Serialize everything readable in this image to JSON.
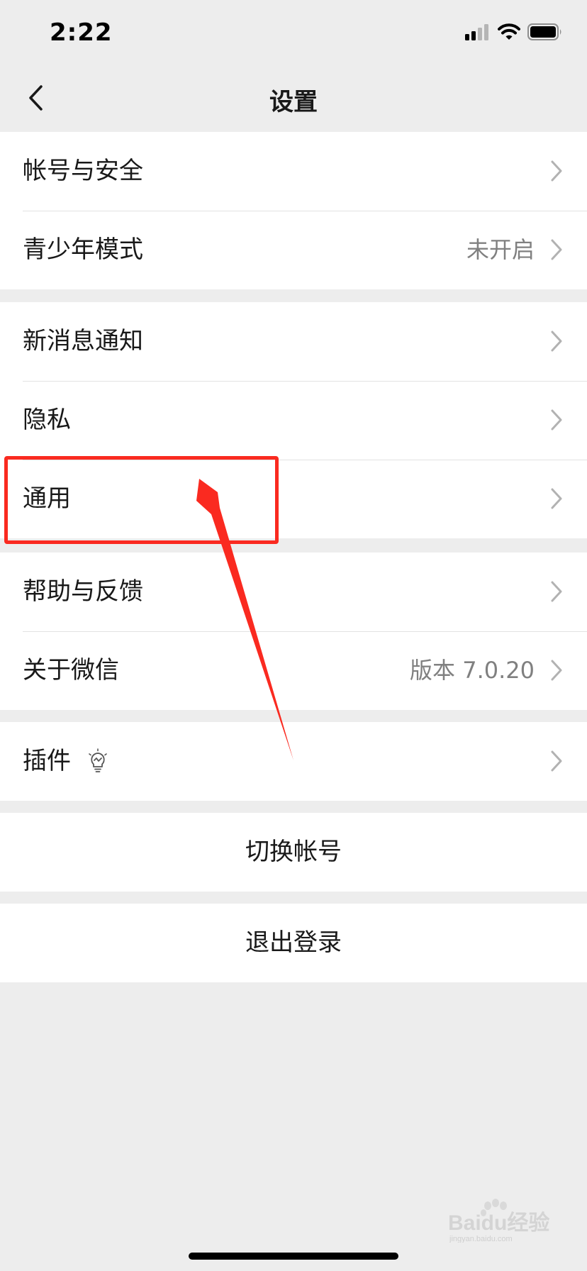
{
  "status_bar": {
    "time": "2:22"
  },
  "nav": {
    "title": "设置"
  },
  "groups": [
    [
      {
        "label": "帐号与安全",
        "value": ""
      },
      {
        "label": "青少年模式",
        "value": "未开启"
      }
    ],
    [
      {
        "label": "新消息通知",
        "value": ""
      },
      {
        "label": "隐私",
        "value": ""
      },
      {
        "label": "通用",
        "value": ""
      }
    ],
    [
      {
        "label": "帮助与反馈",
        "value": ""
      },
      {
        "label": "关于微信",
        "value": "版本 7.0.20"
      }
    ],
    [
      {
        "label": "插件",
        "value": ""
      }
    ]
  ],
  "actions": {
    "switch_account": "切换帐号",
    "logout": "退出登录"
  },
  "watermark": {
    "text": "Baidu经验",
    "sub": "jingyan.baidu.com"
  },
  "icons": [
    "signal-icon",
    "wifi-icon",
    "battery-icon",
    "back-icon",
    "chevron-right-icon",
    "lightbulb-icon"
  ],
  "colors": {
    "background": "#ededed",
    "card": "#ffffff",
    "annotation": "#fa2a20",
    "secondary_text": "#808080"
  }
}
